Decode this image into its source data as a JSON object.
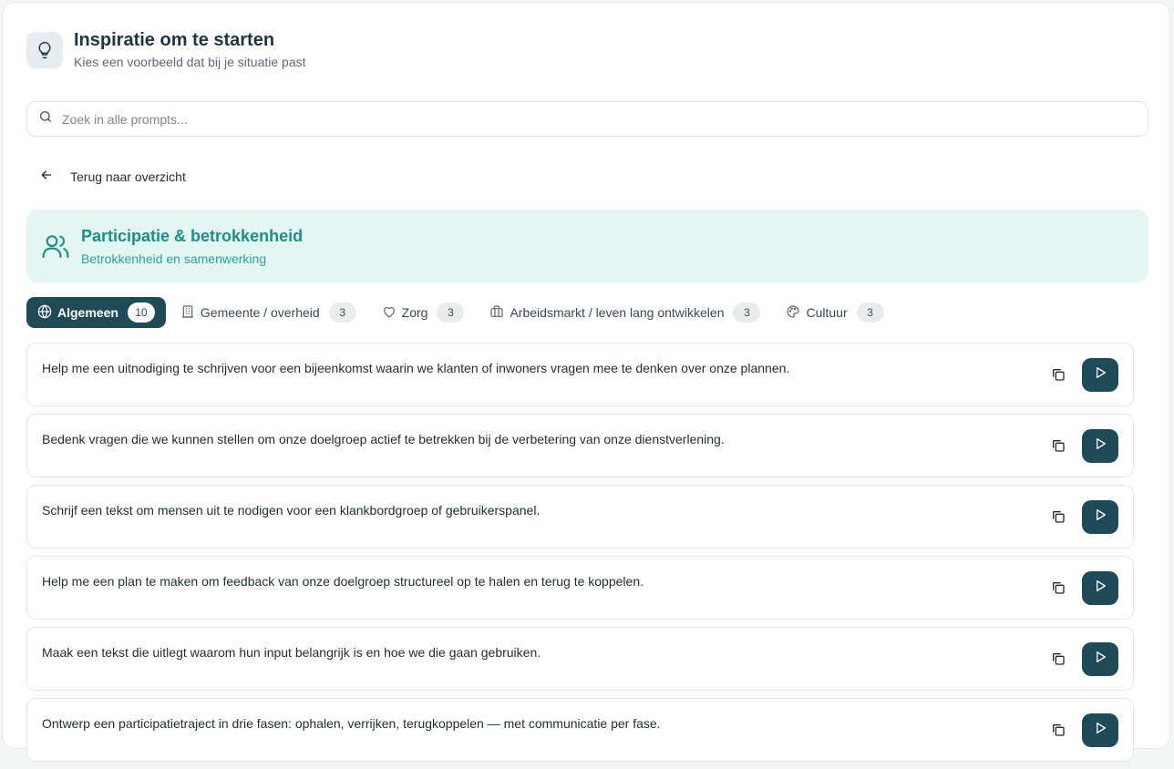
{
  "header": {
    "icon": "lightbulb-icon",
    "title": "Inspiratie om te starten",
    "subtitle": "Kies een voorbeeld dat bij je situatie past"
  },
  "search": {
    "placeholder": "Zoek in alle prompts...",
    "value": ""
  },
  "back": {
    "label": "Terug naar overzicht"
  },
  "category": {
    "icon": "users-icon",
    "title": "Participatie & betrokkenheid",
    "subtitle": "Betrokkenheid en samenwerking"
  },
  "tabs": [
    {
      "label": "Algemeen",
      "count": "10",
      "icon": "globe-icon",
      "active": true
    },
    {
      "label": "Gemeente / overheid",
      "count": "3",
      "icon": "building-icon",
      "active": false
    },
    {
      "label": "Zorg",
      "count": "3",
      "icon": "heart-icon",
      "active": false
    },
    {
      "label": "Arbeidsmarkt / leven lang ontwikkelen",
      "count": "3",
      "icon": "briefcase-icon",
      "active": false
    },
    {
      "label": "Cultuur",
      "count": "3",
      "icon": "palette-icon",
      "active": false
    }
  ],
  "prompts": [
    "Help me een uitnodiging te schrijven voor een bijeenkomst waarin we klanten of inwoners vragen mee te denken over onze plannen.",
    "Bedenk vragen die we kunnen stellen om onze doelgroep actief te betrekken bij de verbetering van onze dienstverlening.",
    "Schrijf een tekst om mensen uit te nodigen voor een klankbordgroep of gebruikerspanel.",
    "Help me een plan te maken om feedback van onze doelgroep structureel op te halen en terug te koppelen.",
    "Maak een tekst die uitlegt waarom hun input belangrijk is en hoe we die gaan gebruiken.",
    "Ontwerp een participatietraject in drie fasen: ophalen, verrijken, terugkoppelen — met communicatie per fase."
  ],
  "colors": {
    "primary": "#1f4b59",
    "accent_teal": "#1a8f86",
    "banner_bg": "#e3f6f3"
  }
}
